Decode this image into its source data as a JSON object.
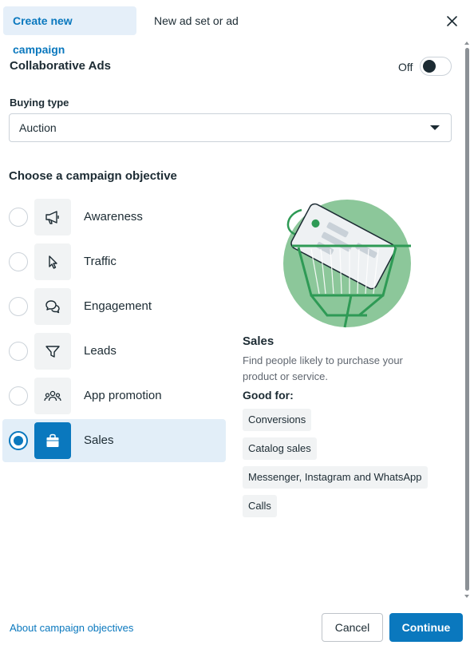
{
  "tabs": {
    "create_new": "Create new campaign",
    "new_ad_set": "New ad set or ad"
  },
  "collaborative_ads": {
    "label": "Collaborative Ads",
    "toggle_text": "Off",
    "enabled": false
  },
  "buying_type": {
    "label": "Buying type",
    "value": "Auction"
  },
  "objective_heading": "Choose a campaign objective",
  "objectives": [
    {
      "label": "Awareness",
      "icon": "megaphone-icon",
      "selected": false
    },
    {
      "label": "Traffic",
      "icon": "cursor-icon",
      "selected": false
    },
    {
      "label": "Engagement",
      "icon": "chat-bubbles-icon",
      "selected": false
    },
    {
      "label": "Leads",
      "icon": "funnel-icon",
      "selected": false
    },
    {
      "label": "App promotion",
      "icon": "people-group-icon",
      "selected": false
    },
    {
      "label": "Sales",
      "icon": "shopping-bag-icon",
      "selected": true
    }
  ],
  "detail": {
    "title": "Sales",
    "description": "Find people likely to purchase your product or service.",
    "good_for_label": "Good for:",
    "tags": [
      "Conversions",
      "Catalog sales",
      "Messenger, Instagram and WhatsApp",
      "Calls"
    ]
  },
  "footer": {
    "about_link": "About campaign objectives",
    "cancel": "Cancel",
    "continue": "Continue"
  },
  "colors": {
    "accent": "#0a78be",
    "selected_bg": "#e2eef8",
    "illustration_green": "#8cc79a"
  }
}
